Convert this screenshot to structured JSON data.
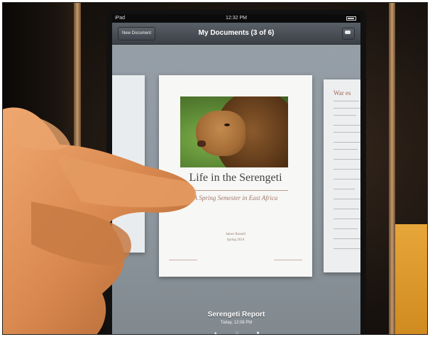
{
  "status_bar": {
    "carrier": "iPad",
    "time": "12:32 PM"
  },
  "toolbar": {
    "new_document_label": "New Document",
    "title": "My Documents (3 of 6)"
  },
  "icons": {
    "comment": "speech-bubble-icon",
    "battery": "battery-icon"
  },
  "document": {
    "title": "Life in the Serengeti",
    "subtitle": "A Spring Semester in East Africa",
    "author": "James Russell",
    "date": "Spring 2010"
  },
  "right_document": {
    "title": "War es"
  },
  "document_info": {
    "name": "Serengeti Report",
    "modified": "Today, 12:08 PM"
  },
  "colors": {
    "toolbar": "#4a5058",
    "screen_background": "#8e979f",
    "skin": "#d9894f"
  }
}
